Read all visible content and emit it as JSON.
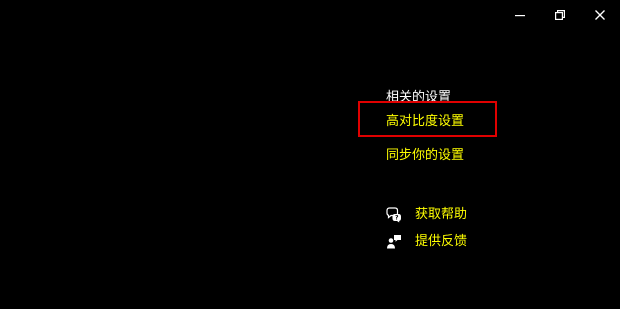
{
  "window_controls": {
    "minimize": "minimize-icon",
    "restore": "restore-icon",
    "close": "close-icon"
  },
  "related_settings": {
    "heading": "相关的设置",
    "links": [
      {
        "label": "高对比度设置"
      },
      {
        "label": "同步你的设置"
      }
    ]
  },
  "help": {
    "items": [
      {
        "icon": "chat-help-icon",
        "label": "获取帮助"
      },
      {
        "icon": "feedback-icon",
        "label": "提供反馈"
      }
    ]
  },
  "colors": {
    "background": "#000000",
    "text": "#ffffff",
    "link": "#ffff00",
    "highlight_box": "#e00000"
  }
}
